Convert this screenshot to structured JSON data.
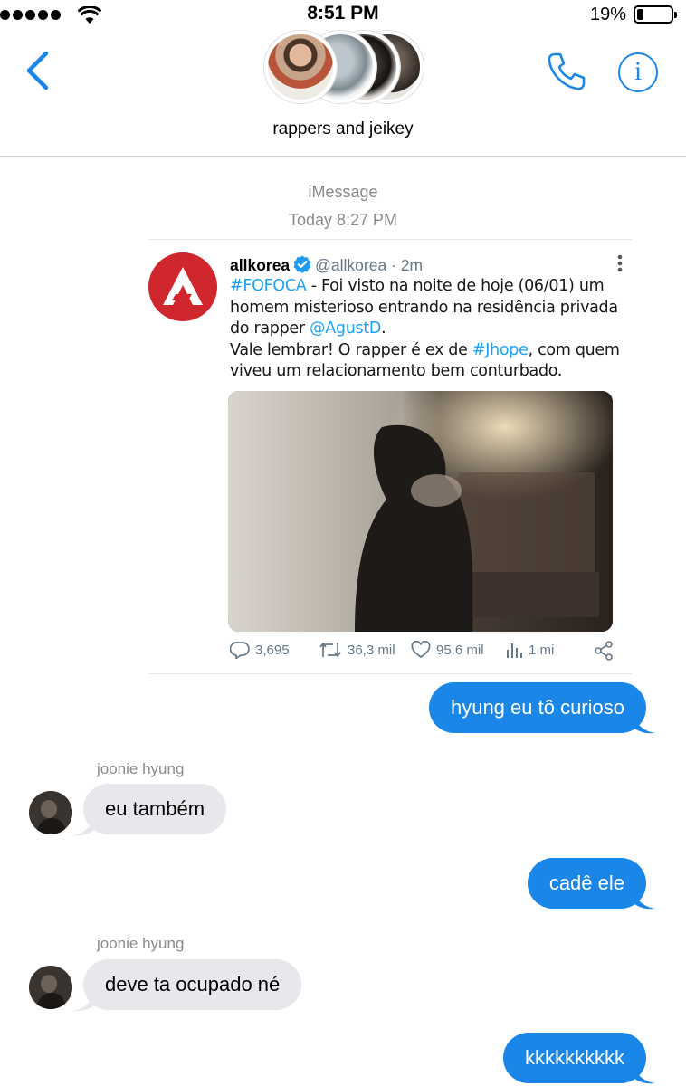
{
  "status_bar": {
    "time": "8:51 PM",
    "battery": "19%",
    "battery_level": 0.19
  },
  "header": {
    "group_name": "rappers and jeikey"
  },
  "thread": {
    "service": "iMessage",
    "timestamp": "Today 8:27 PM"
  },
  "tweet": {
    "name": "allkorea",
    "handle": "@allkorea",
    "sep": "·",
    "age": "2m",
    "body": {
      "hashtag1": "#FOFOCA",
      "text1": " - Foi visto na noite de hoje (06/01) um homem misterioso entrando na residência privada do rapper ",
      "mention": "@AgustD",
      "text2": ".",
      "text3": "Vale lembrar! O rapper é ex de ",
      "hashtag2": "#Jhope",
      "text4": ", com quem viveu um relacionamento bem conturbado."
    },
    "replies": "3,695",
    "retweets": "36,3 mil",
    "likes": "95,6 mil",
    "views": "1 mi"
  },
  "messages": [
    {
      "from": "me",
      "text": "hyung eu tô curioso"
    },
    {
      "from": "joonie hyung",
      "sender_label": "joonie hyung",
      "text": "eu também"
    },
    {
      "from": "me",
      "text": "cadê ele"
    },
    {
      "from": "joonie hyung",
      "sender_label": "joonie hyung",
      "text": "deve ta ocupado né"
    },
    {
      "from": "me",
      "text": "kkkkkkkkkk"
    }
  ],
  "colors": {
    "accent": "#1a86e8",
    "incoming_bubble": "#e8e8ec",
    "twitter_link": "#1da1f2",
    "logo_red": "#d0262e"
  }
}
